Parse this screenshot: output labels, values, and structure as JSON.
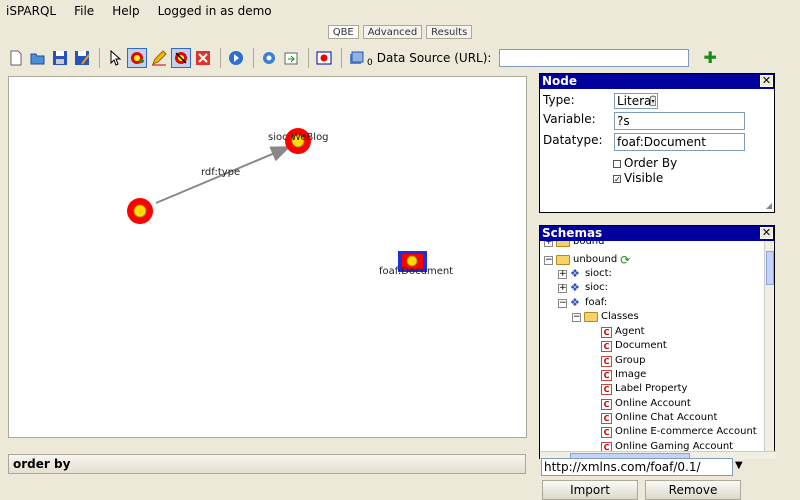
{
  "menu": [
    "iSPARQL",
    "File",
    "Help",
    "Logged in as demo"
  ],
  "tabs": [
    "QBE",
    "Advanced",
    "Results"
  ],
  "toolbar": {
    "icons": [
      "new-icon",
      "open-icon",
      "save-icon",
      "save-as-icon",
      "pointer-icon",
      "add-node-icon",
      "edit-icon",
      "delete-node-icon",
      "delete-icon",
      "run-icon",
      "settings-icon",
      "export-icon",
      "load-icon",
      "datasets-icon"
    ],
    "dataset_count": "0",
    "data_source_label": "Data Source (URL):",
    "data_source_value": ""
  },
  "graph": {
    "edge_label": "rdf:type",
    "node_labels": [
      "sioc:WeBlog",
      "foaf:Document"
    ]
  },
  "order_by": "order by",
  "node_panel": {
    "title": "Node",
    "type_label": "Type:",
    "type_value": "Literal",
    "variable_label": "Variable:",
    "variable_value": "?s",
    "datatype_label": "Datatype:",
    "datatype_value": "foaf:Document",
    "order_by_label": "Order By",
    "visible_label": "Visible"
  },
  "schemas_panel": {
    "title": "Schemas",
    "tree": [
      "bound",
      "unbound",
      "sioct:",
      "sioc:",
      "foaf:",
      "Classes"
    ],
    "classes": [
      "Agent",
      "Document",
      "Group",
      "Image",
      "Label Property",
      "Online Account",
      "Online Chat Account",
      "Online E-commerce Account",
      "Online Gaming Account"
    ],
    "url_value": "http://xmlns.com/foaf/0.1/",
    "import_label": "Import",
    "remove_label": "Remove"
  }
}
